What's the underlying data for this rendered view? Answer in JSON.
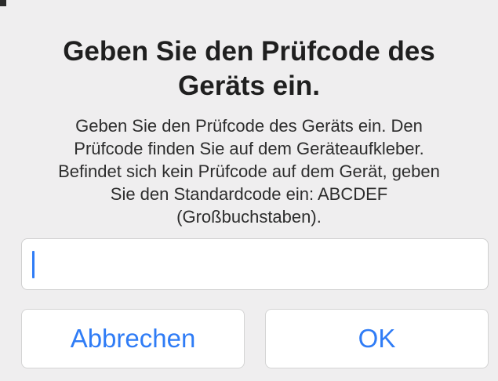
{
  "dialog": {
    "title": "Geben Sie den Prüfcode des Geräts ein.",
    "message_lines": [
      "Geben Sie den Prüfcode des Geräts ein. Den",
      "Prüfcode finden Sie auf dem Geräteaufkleber.",
      "Befindet sich kein Prüfcode auf dem Gerät, geben",
      "Sie den Standardcode ein: ABCDEF",
      "(Großbuchstaben)."
    ],
    "input_value": "",
    "cancel_label": "Abbrechen",
    "ok_label": "OK"
  },
  "colors": {
    "accent": "#2f7cf6",
    "background": "#efeeef",
    "text": "#1f1f1f"
  }
}
